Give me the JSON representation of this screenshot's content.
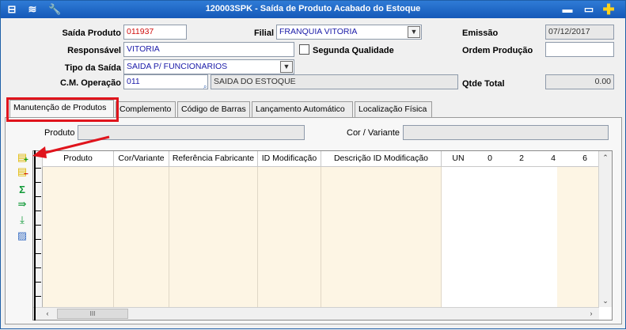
{
  "window": {
    "title": "120003SPK - Saída de Produto Acabado do Estoque",
    "controls": {
      "minimize": "▬",
      "maximize": "▭",
      "add": "✚"
    }
  },
  "toolbar_icons": [
    "window-icon",
    "stack-icon",
    "wrench-icon"
  ],
  "form": {
    "saida_produto": {
      "label": "Saída Produto",
      "value": "011937"
    },
    "filial": {
      "label": "Filial",
      "value": "FRANQUIA VITORIA"
    },
    "emissao": {
      "label": "Emissão",
      "value": "07/12/2017"
    },
    "responsavel": {
      "label": "Responsável",
      "value": "VITORIA"
    },
    "segunda_qualidade": {
      "label": "Segunda Qualidade",
      "checked": false
    },
    "ordem_producao": {
      "label": "Ordem Produção",
      "value": ""
    },
    "tipo_saida": {
      "label": "Tipo da Saída",
      "value": "SAIDA P/ FUNCIONARIOS"
    },
    "cm_operacao": {
      "label": "C.M. Operação",
      "value": "011",
      "description": "SAIDA DO ESTOQUE"
    },
    "qtde_total": {
      "label": "Qtde Total",
      "value": "0.00"
    }
  },
  "tabs": [
    {
      "label": "Manutenção de Produtos",
      "active": true
    },
    {
      "label": "Complemento",
      "active": false
    },
    {
      "label": "Código de Barras",
      "active": false
    },
    {
      "label": "Lançamento Automático",
      "active": false
    },
    {
      "label": "Localização Física",
      "active": false
    }
  ],
  "panel": {
    "produto_label": "Produto",
    "produto_value": "",
    "cor_variante_label": "Cor / Variante",
    "cor_variante_value": ""
  },
  "grid": {
    "columns": [
      "Produto",
      "Cor/Variante",
      "Referência Fabricante",
      "ID Modificação",
      "Descrição ID Modificação",
      "UN",
      "0",
      "2",
      "4",
      "6"
    ],
    "rows": [],
    "hscroll_thumb": "III"
  },
  "annotation": {
    "color": "#e0141c"
  }
}
